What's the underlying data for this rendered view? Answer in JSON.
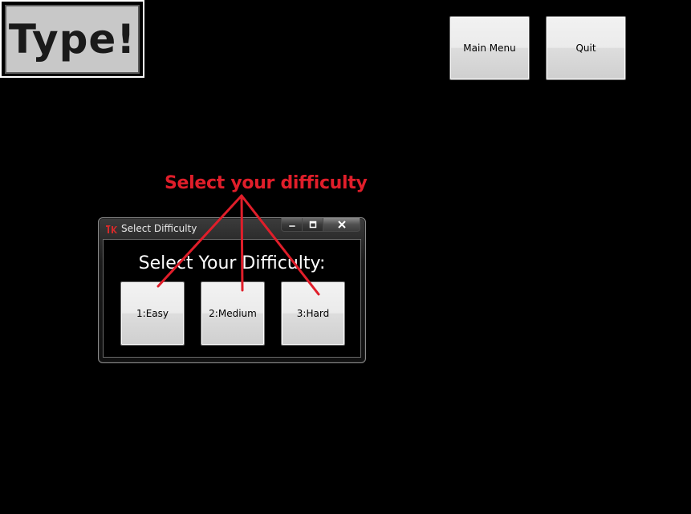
{
  "logo": {
    "text": "Type!"
  },
  "toolbar": {
    "main_menu_label": "Main Menu",
    "quit_label": "Quit"
  },
  "annotation": {
    "text": "Select your difficulty",
    "color": "#e01e2a"
  },
  "dialog": {
    "title": "Select Difficulty",
    "heading": "Select Your Difficulty:",
    "buttons": [
      {
        "label": "1:Easy"
      },
      {
        "label": "2:Medium"
      },
      {
        "label": "3:Hard"
      }
    ],
    "window_controls": [
      "minimize-icon",
      "maximize-icon",
      "close-icon"
    ]
  },
  "colors": {
    "background": "#000000",
    "button_face": "#e6e6e6",
    "logo_face": "#c8c8c8"
  }
}
